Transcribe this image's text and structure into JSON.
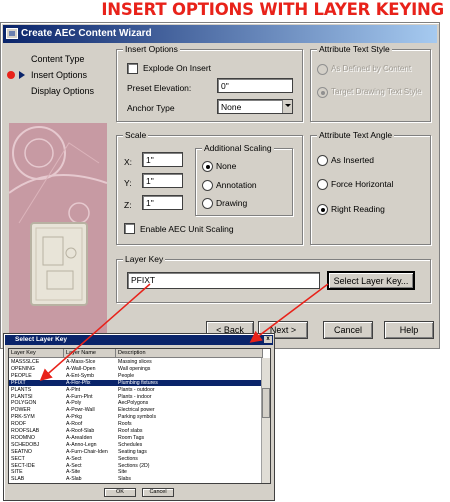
{
  "banner": "INSERT OPTIONS WITH LAYER KEYING",
  "wizard": {
    "title": "Create AEC Content Wizard",
    "steps": [
      "Content Type",
      "Insert Options",
      "Display Options"
    ],
    "current_step": "Insert Options"
  },
  "insert_options": {
    "group_label": "Insert Options",
    "explode_label": "Explode On Insert",
    "explode_checked": false,
    "preset_elevation_label": "Preset Elevation:",
    "preset_elevation_value": "0\"",
    "anchor_type_label": "Anchor Type",
    "anchor_type_value": "None"
  },
  "attribute_text_style": {
    "group_label": "Attribute Text Style",
    "options": [
      "As Defined by Content",
      "Target Drawing Text Style"
    ],
    "selected": "Target Drawing Text Style",
    "enabled": false
  },
  "scale": {
    "group_label": "Scale",
    "x_label": "X:",
    "x_value": "1\"",
    "y_label": "Y:",
    "y_value": "1\"",
    "z_label": "Z:",
    "z_value": "1\"",
    "additional_label": "Additional Scaling",
    "additional_options": [
      "None",
      "Annotation",
      "Drawing"
    ],
    "additional_selected": "None",
    "aec_unit_label": "Enable AEC Unit Scaling",
    "aec_unit_checked": false
  },
  "attribute_text_angle": {
    "group_label": "Attribute Text Angle",
    "options": [
      "As Inserted",
      "Force Horizontal",
      "Right Reading"
    ],
    "selected": "Right Reading"
  },
  "layer_key": {
    "group_label": "Layer Key",
    "value": "PFIXT",
    "button_label": "Select Layer Key..."
  },
  "buttons": {
    "back": "< Back",
    "next": "Next >",
    "cancel": "Cancel",
    "help": "Help"
  },
  "layer_key_dialog": {
    "title": "Select Layer Key",
    "columns": [
      "Layer Key",
      "Layer Name",
      "Description"
    ],
    "rows": [
      [
        "MASSSLCE",
        "A-Mass-Slce",
        "Massing slices"
      ],
      [
        "OPENING",
        "A-Wall-Open",
        "Wall openings"
      ],
      [
        "PEOPLE",
        "A-Ent-Symb",
        "People"
      ],
      [
        "PFIXT",
        "A-Flor-Pfix",
        "Plumbing fixtures"
      ],
      [
        "PLANTS",
        "A-Plnt",
        "Plants - outdoor"
      ],
      [
        "PLANTSI",
        "A-Furn-Plnt",
        "Plants - indoor"
      ],
      [
        "POLYGON",
        "A-Poly",
        "AecPolygons"
      ],
      [
        "POWER",
        "A-Powr-Wall",
        "Electrical power"
      ],
      [
        "PRK-SYM",
        "A-Prkg",
        "Parking symbols"
      ],
      [
        "ROOF",
        "A-Roof",
        "Roofs"
      ],
      [
        "ROOFSLAB",
        "A-Roof-Slab",
        "Roof slabs"
      ],
      [
        "ROOMNO",
        "A-AreaIden",
        "Room Tags"
      ],
      [
        "SCHEDOBJ",
        "A-Anno-Legn",
        "Schedules"
      ],
      [
        "SEATNO",
        "A-Furn-Chair-Iden",
        "Seating tags"
      ],
      [
        "SECT",
        "A-Sect",
        "Sections"
      ],
      [
        "SECT-IDE",
        "A-Sect",
        "Sections (2D)"
      ],
      [
        "SITE",
        "A-Site",
        "Site"
      ],
      [
        "SLAB",
        "A-Slab",
        "Slabs"
      ]
    ],
    "selected_row": "PFIXT",
    "ok": "OK",
    "cancel": "Cancel"
  }
}
